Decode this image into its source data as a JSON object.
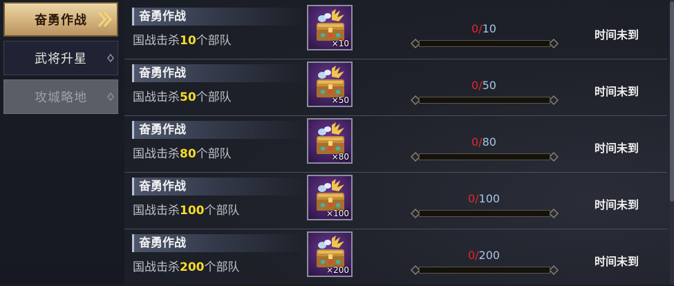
{
  "sidebar": {
    "tabs": [
      {
        "label": "奋勇作战",
        "state": "active"
      },
      {
        "label": "武将升星",
        "state": "normal"
      },
      {
        "label": "攻城略地",
        "state": "disabled"
      }
    ]
  },
  "tasks": [
    {
      "title": "奋勇作战",
      "desc_prefix": "国战击杀",
      "desc_num": "10",
      "desc_suffix": "个部队",
      "reward_count": "×10",
      "progress_current": "0",
      "progress_total": "10",
      "progress_fraction": 0.0,
      "status": "时间未到"
    },
    {
      "title": "奋勇作战",
      "desc_prefix": "国战击杀",
      "desc_num": "50",
      "desc_suffix": "个部队",
      "reward_count": "×50",
      "progress_current": "0",
      "progress_total": "50",
      "progress_fraction": 0.0,
      "status": "时间未到"
    },
    {
      "title": "奋勇作战",
      "desc_prefix": "国战击杀",
      "desc_num": "80",
      "desc_suffix": "个部队",
      "reward_count": "×80",
      "progress_current": "0",
      "progress_total": "80",
      "progress_fraction": 0.0,
      "status": "时间未到"
    },
    {
      "title": "奋勇作战",
      "desc_prefix": "国战击杀",
      "desc_num": "100",
      "desc_suffix": "个部队",
      "reward_count": "×100",
      "progress_current": "0",
      "progress_total": "100",
      "progress_fraction": 0.0,
      "status": "时间未到"
    },
    {
      "title": "奋勇作战",
      "desc_prefix": "国战击杀",
      "desc_num": "200",
      "desc_suffix": "个部队",
      "reward_count": "×200",
      "progress_current": "0",
      "progress_total": "200",
      "progress_fraction": 0.0,
      "status": "时间未到"
    }
  ],
  "icons": {
    "reward": "treasure-chest-icon",
    "tab_arrow": "double-chevron-icon"
  },
  "colors": {
    "accent_gold": "#d3b27c",
    "highlight_number": "#f7dc2b",
    "progress_current": "#e1292d",
    "progress_total": "#a9c5e6"
  }
}
